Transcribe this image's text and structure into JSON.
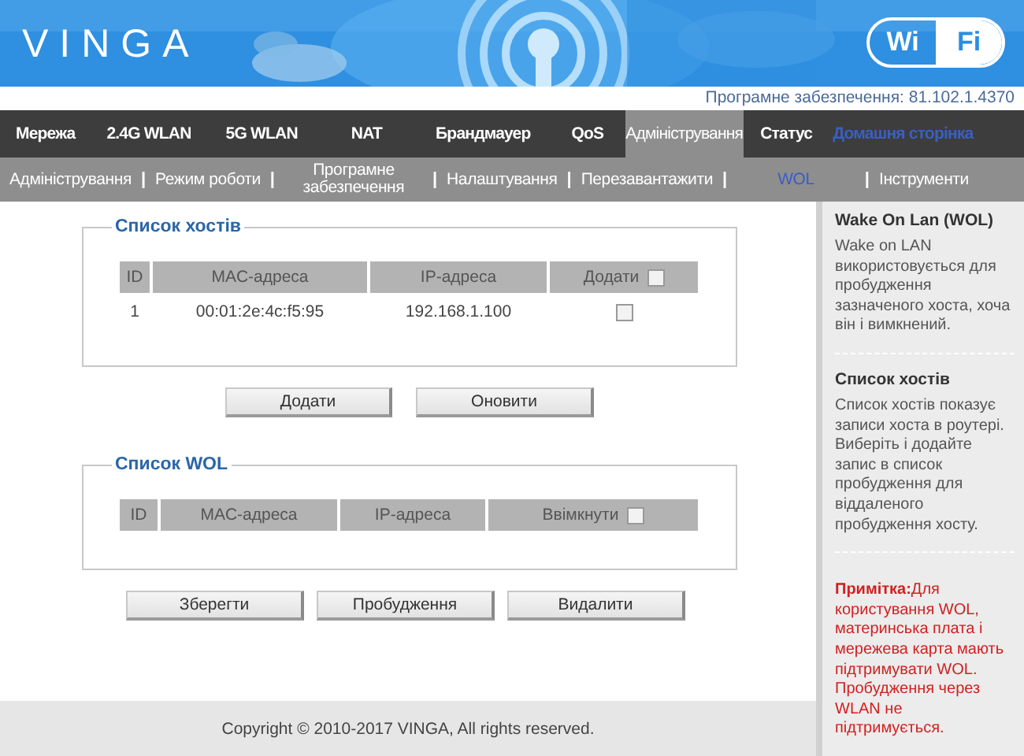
{
  "header": {
    "logo": "VINGA",
    "wifi_logo": [
      "Wi",
      "Fi"
    ]
  },
  "version": "Програмне забезпечення: 81.102.1.4370",
  "nav": [
    {
      "label": "Мережа",
      "selected": false,
      "kind": "tab"
    },
    {
      "label": "2.4G WLAN",
      "selected": false,
      "kind": "tab"
    },
    {
      "label": "5G WLAN",
      "selected": false,
      "kind": "tab"
    },
    {
      "label": "NAT",
      "selected": false,
      "kind": "tab"
    },
    {
      "label": "Брандмауер",
      "selected": false,
      "kind": "tab"
    },
    {
      "label": "QoS",
      "selected": false,
      "kind": "tab"
    },
    {
      "label": "Адміністрування",
      "selected": true,
      "kind": "tab"
    },
    {
      "label": "Статус",
      "selected": false,
      "kind": "tab"
    },
    {
      "label": "Домашня сторінка",
      "selected": false,
      "kind": "link"
    }
  ],
  "subnav": [
    {
      "label": "Адміністрування",
      "selected": false,
      "kind": "link"
    },
    {
      "label": "|",
      "kind": "separator"
    },
    {
      "label": "Режим роботи",
      "selected": false,
      "kind": "link"
    },
    {
      "label": "|",
      "kind": "separator"
    },
    {
      "label": "Програмне забезпечення",
      "selected": false,
      "kind": "link"
    },
    {
      "label": "|",
      "kind": "separator"
    },
    {
      "label": "Налаштування",
      "selected": false,
      "kind": "link"
    },
    {
      "label": "|",
      "kind": "separator"
    },
    {
      "label": "Перезавантажити",
      "selected": false,
      "kind": "link"
    },
    {
      "label": "|",
      "kind": "separator"
    },
    {
      "label": "WOL",
      "selected": true,
      "kind": "link"
    },
    {
      "label": "|",
      "kind": "separator"
    },
    {
      "label": "Інструменти",
      "selected": false,
      "kind": "link"
    }
  ],
  "host_list": {
    "title": "Список хостів",
    "columns": [
      "ID",
      "MAC-адреса",
      "IP-адреса",
      "Додати"
    ],
    "header_checked": false,
    "rows": [
      {
        "cells": [
          "1",
          "00:01:2e:4c:f5:95",
          "192.168.1.100"
        ],
        "checked": false
      }
    ],
    "buttons": [
      "Додати",
      "Оновити"
    ]
  },
  "wol_list": {
    "title": "Список WOL",
    "columns": [
      "ID",
      "MAC-адреса",
      "IP-адреса",
      "Ввімкнути"
    ],
    "header_checked": false,
    "buttons": [
      "Зберегти",
      "Пробудження",
      "Видалити"
    ]
  },
  "sidebar": [
    {
      "kind": "section",
      "title": "Wake On Lan (WOL)",
      "text": "Wake on LAN використовується для пробудження зазначеного хоста, хоча він і вимкнений."
    },
    {
      "kind": "section",
      "title": "Список хостів",
      "text": "Список хостів показує записи хоста в роутері. Виберіть і додайте запис в список пробудження для віддаленого пробудження хосту."
    },
    {
      "kind": "note",
      "text": "**Примітка:**Для користування WOL, материнська плата і мережева карта мають підтримувати WOL. Пробудження через WLAN не підтримується."
    }
  ],
  "footer": "Copyright © 2010-2017 VINGA, All rights reserved."
}
